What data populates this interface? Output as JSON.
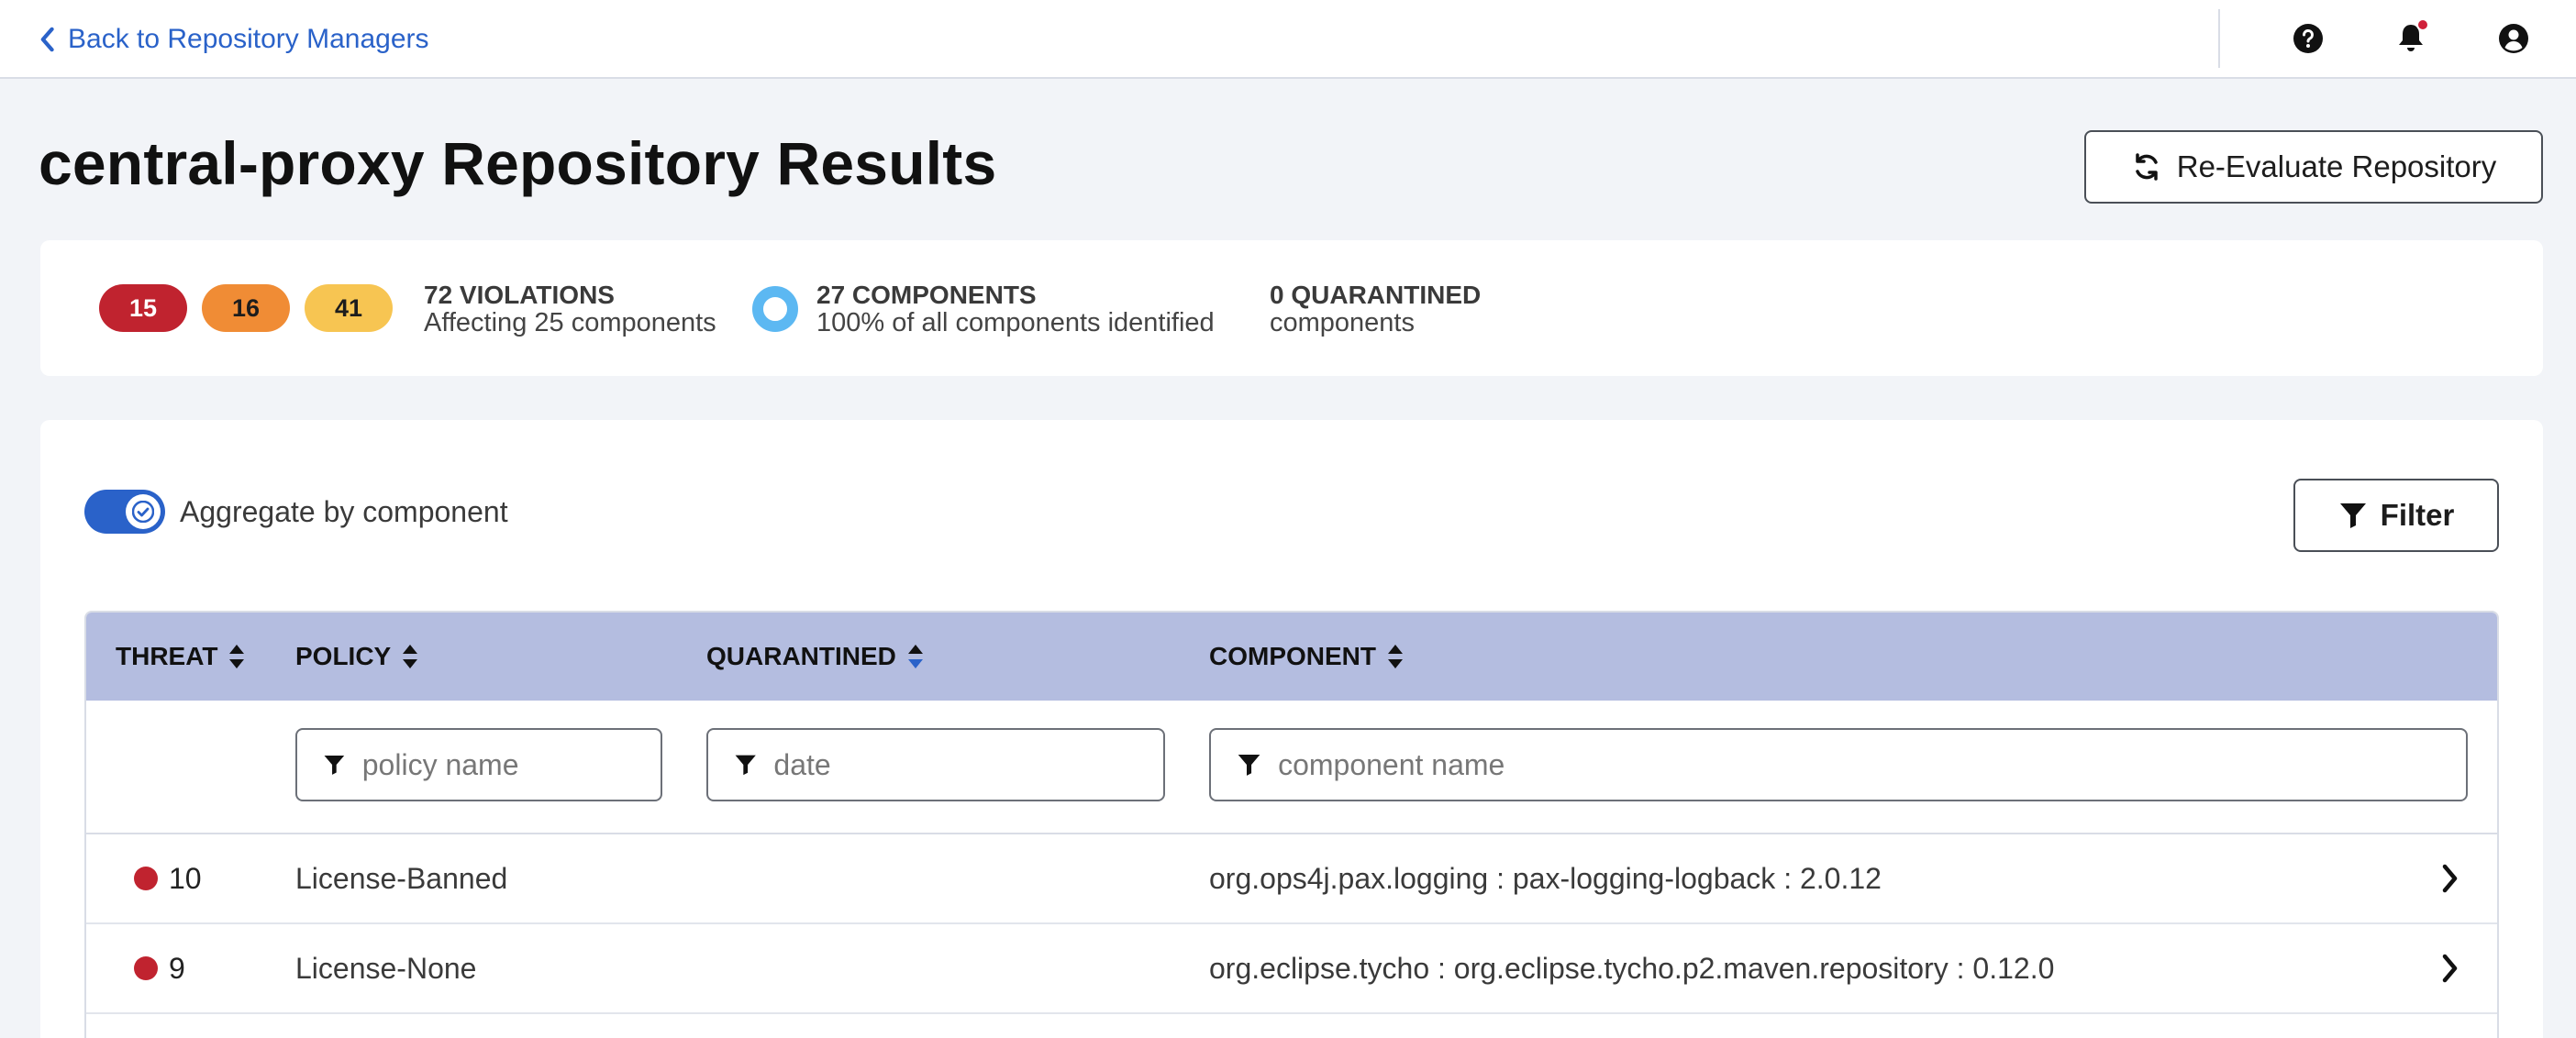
{
  "topbar": {
    "back_label": "Back to Repository Managers",
    "icons": [
      "help-icon",
      "bell-icon",
      "user-icon"
    ]
  },
  "header": {
    "title": "central-proxy Repository Results",
    "reevaluate_label": "Re-Evaluate Repository"
  },
  "summary": {
    "pills": [
      {
        "value": "15",
        "color": "#c0232f",
        "text_color": "#ffffff"
      },
      {
        "value": "16",
        "color": "#f08c35",
        "text_color": "#1d1d1d"
      },
      {
        "value": "41",
        "color": "#f7c552",
        "text_color": "#1d1d1d"
      }
    ],
    "violations": {
      "title": "72 VIOLATIONS",
      "subtitle": "Affecting 25 components"
    },
    "components": {
      "title": "27 COMPONENTS",
      "subtitle": "100% of all components identified"
    },
    "quarantined": {
      "title": "0 QUARANTINED",
      "subtitle": "components"
    }
  },
  "controls": {
    "aggregate_label": "Aggregate by component",
    "aggregate_on": true,
    "filter_label": "Filter"
  },
  "table": {
    "headers": {
      "threat": "THREAT",
      "policy": "POLICY",
      "quarantined": "QUARANTINED",
      "component": "COMPONENT"
    },
    "filters": {
      "policy_placeholder": "policy name",
      "date_placeholder": "date",
      "component_placeholder": "component name"
    },
    "rows": [
      {
        "threat": "10",
        "policy": "License-Banned",
        "quarantined": "",
        "component": "org.ops4j.pax.logging : pax-logging-logback : 2.0.12"
      },
      {
        "threat": "9",
        "policy": "License-None",
        "quarantined": "",
        "component": "org.eclipse.tycho : org.eclipse.tycho.p2.maven.repository : 0.12.0"
      }
    ]
  },
  "colors": {
    "accent": "#2a62c9",
    "header_bg": "#b4bde0",
    "threat_red": "#c0232f",
    "ring_blue": "#5cb8f2"
  }
}
